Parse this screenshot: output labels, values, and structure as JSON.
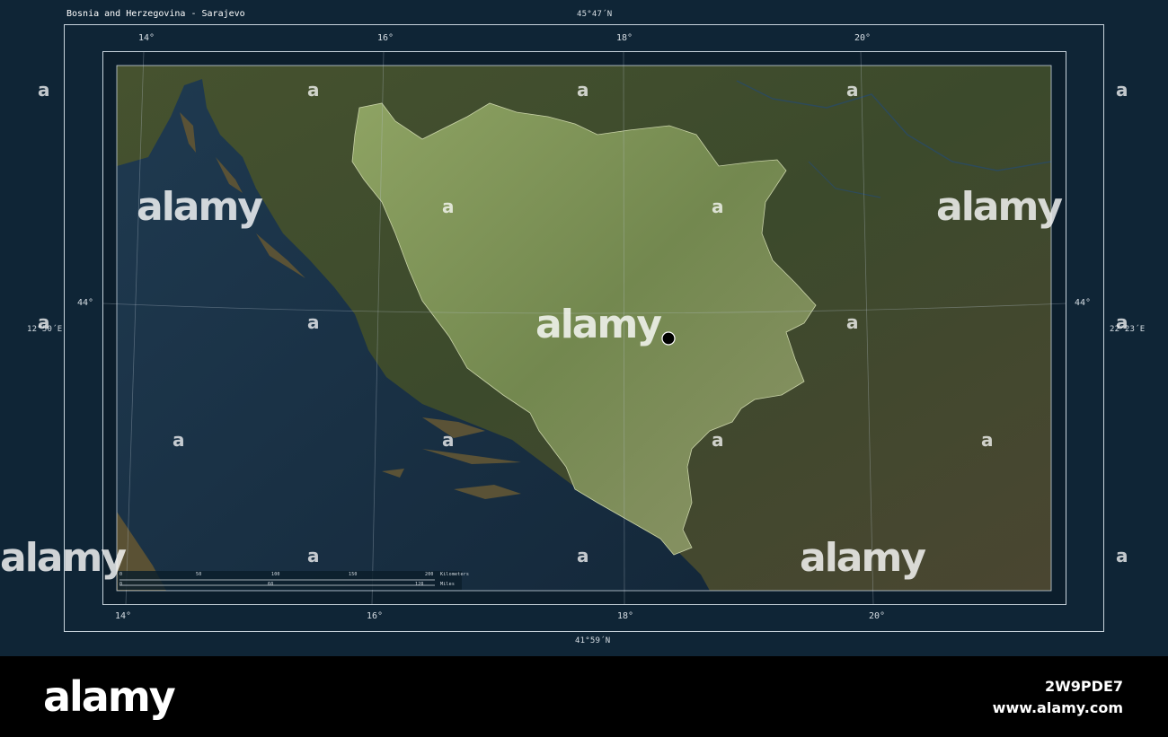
{
  "map": {
    "title": "Bosnia and Herzegovina - Sarajevo",
    "top_lat_label": "45°47´N",
    "bottom_lat_label": "41°59´N",
    "left_lon_label": "12°50´E",
    "right_lon_label": "22°23´E",
    "top_lon_ticks": [
      "14°",
      "16°",
      "18°",
      "20°"
    ],
    "bottom_lon_ticks": [
      "14°",
      "16°",
      "18°",
      "20°"
    ],
    "left_lat_tick": "44°",
    "right_lat_tick": "44°",
    "scale_bar": {
      "km_ticks": [
        "0",
        "25",
        "50",
        "75",
        "100",
        "125",
        "150",
        "175",
        "200"
      ],
      "km_unit": "Kilometers",
      "mi_ticks": [
        "0",
        "20",
        "40",
        "60",
        "80",
        "100",
        "120"
      ],
      "mi_unit": "Miles"
    },
    "capital_marker": "Sarajevo",
    "colors": {
      "sea": "#1b3346",
      "land": "#3f4a31",
      "highlight": "#7e9159",
      "frame": "#0f2536"
    }
  },
  "watermarks": {
    "small_glyph": "a",
    "large_text": "alamy"
  },
  "footer": {
    "brand": "alamy",
    "image_id": "2W9PDE7",
    "url": "www.alamy.com"
  }
}
